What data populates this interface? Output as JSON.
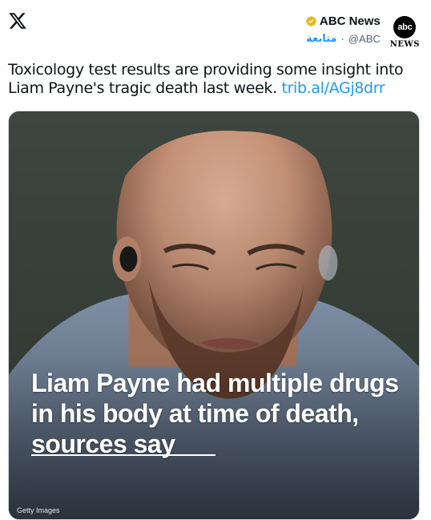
{
  "header": {
    "platform_logo_icon": "x-logo-icon",
    "author_name": "ABC News",
    "verified_badge_icon": "gold-verified-badge-icon",
    "follow_label": "متابعة",
    "handle_separator": "·",
    "handle": "@ABC",
    "avatar": {
      "circle_text": "abc",
      "subtext": "NEWS"
    }
  },
  "tweet": {
    "text": "Toxicology test results are providing some insight into Liam Payne's tragic death last week. ",
    "link_text": "trib.al/AGj8drr"
  },
  "media": {
    "headline": "Liam Payne had multiple drugs in his body at time of death, sources say",
    "credit": "Getty Images"
  },
  "colors": {
    "link": "#1d9bf0",
    "verified_gold": "#e2b719",
    "text_primary": "#0f1419",
    "text_secondary": "#536471"
  }
}
